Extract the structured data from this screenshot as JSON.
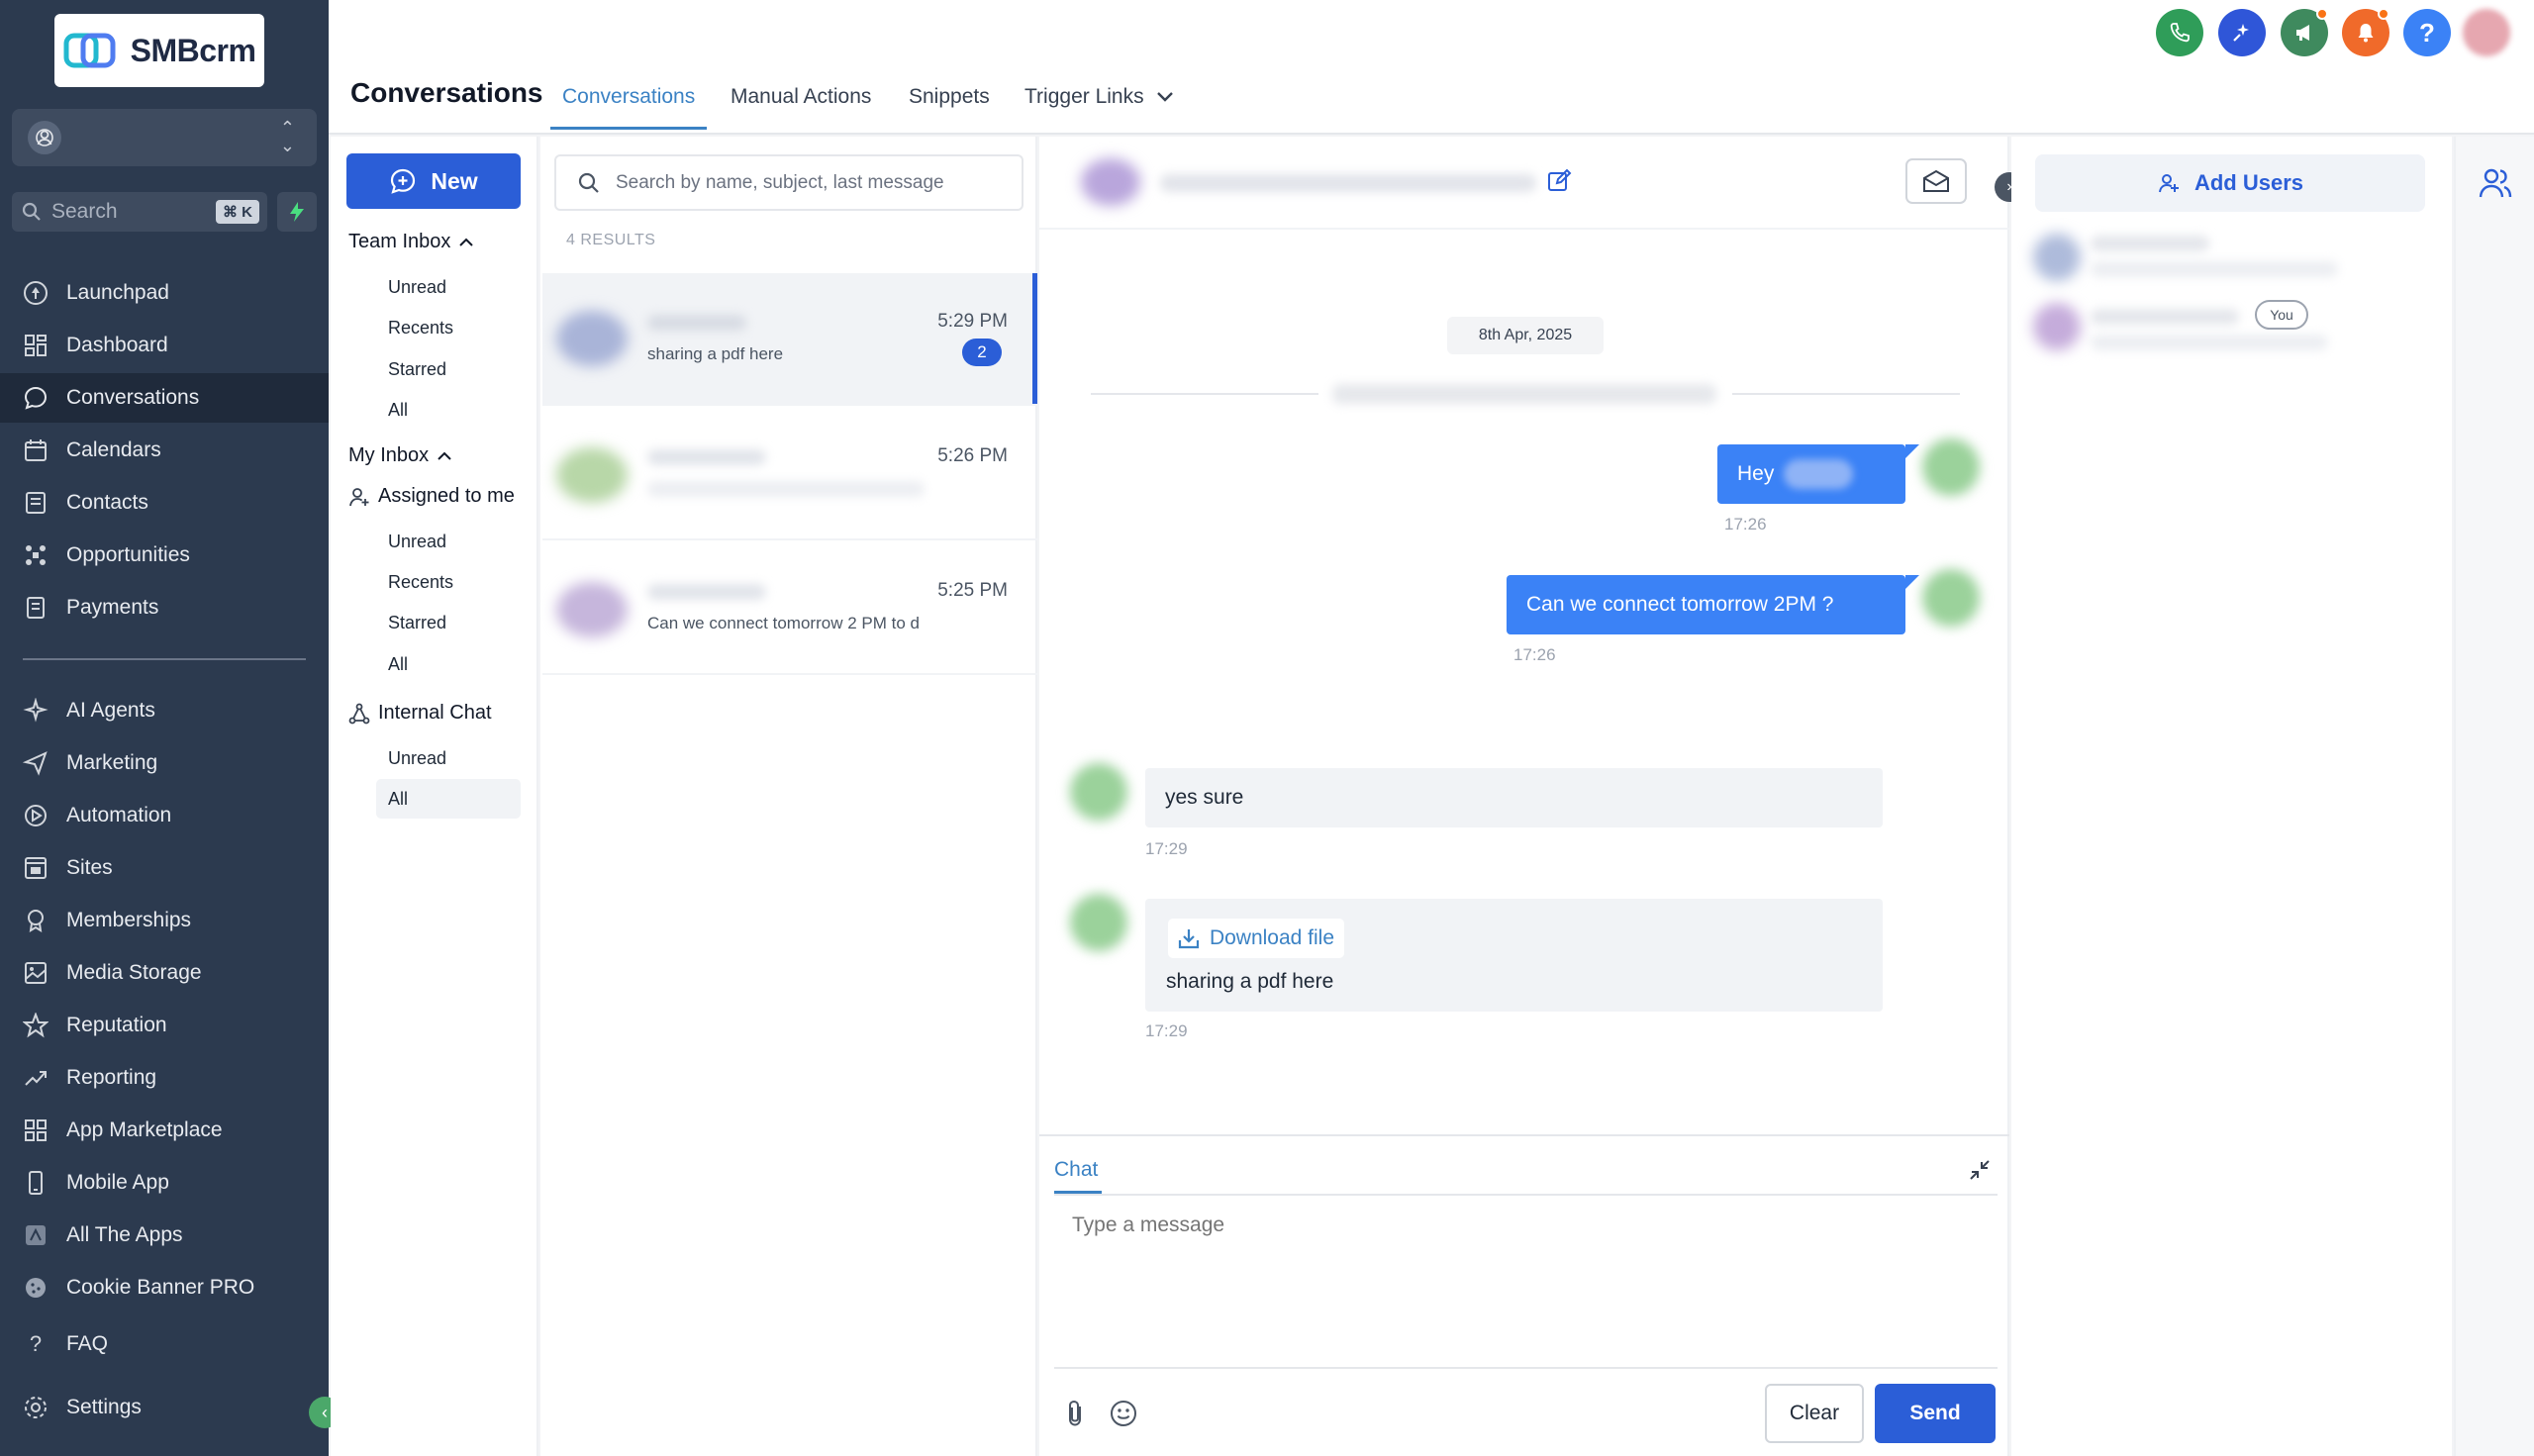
{
  "brand": {
    "name": "SMBcrm"
  },
  "sidebar": {
    "search_label": "Search",
    "search_shortcut": "⌘ K",
    "items": [
      {
        "label": "Launchpad",
        "icon": "launchpad-icon"
      },
      {
        "label": "Dashboard",
        "icon": "dashboard-icon"
      },
      {
        "label": "Conversations",
        "icon": "conversations-icon",
        "active": true
      },
      {
        "label": "Calendars",
        "icon": "calendar-icon"
      },
      {
        "label": "Contacts",
        "icon": "contacts-icon"
      },
      {
        "label": "Opportunities",
        "icon": "opportunities-icon"
      },
      {
        "label": "Payments",
        "icon": "payments-icon"
      },
      {
        "label": "AI Agents",
        "icon": "ai-agents-icon"
      },
      {
        "label": "Marketing",
        "icon": "marketing-icon"
      },
      {
        "label": "Automation",
        "icon": "automation-icon"
      },
      {
        "label": "Sites",
        "icon": "sites-icon"
      },
      {
        "label": "Memberships",
        "icon": "memberships-icon"
      },
      {
        "label": "Media Storage",
        "icon": "media-storage-icon"
      },
      {
        "label": "Reputation",
        "icon": "reputation-icon"
      },
      {
        "label": "Reporting",
        "icon": "reporting-icon"
      },
      {
        "label": "App Marketplace",
        "icon": "app-marketplace-icon"
      },
      {
        "label": "Mobile App",
        "icon": "mobile-app-icon"
      },
      {
        "label": "All The Apps",
        "icon": "all-apps-icon"
      },
      {
        "label": "Cookie Banner PRO",
        "icon": "cookie-icon"
      },
      {
        "label": "FAQ",
        "icon": "faq-icon"
      },
      {
        "label": "Settings",
        "icon": "settings-icon"
      }
    ]
  },
  "header": {
    "title": "Conversations",
    "tabs": [
      {
        "label": "Conversations",
        "active": true
      },
      {
        "label": "Manual Actions"
      },
      {
        "label": "Snippets"
      },
      {
        "label": "Trigger Links"
      }
    ]
  },
  "inbox": {
    "new_label": "New",
    "team_inbox": {
      "label": "Team Inbox",
      "items": [
        "Unread",
        "Recents",
        "Starred",
        "All"
      ]
    },
    "my_inbox": {
      "label": "My Inbox",
      "assigned_label": "Assigned to me",
      "items": [
        "Unread",
        "Recents",
        "Starred",
        "All"
      ]
    },
    "internal_chat": {
      "label": "Internal Chat",
      "items": [
        "Unread",
        "All"
      ]
    }
  },
  "conv_list": {
    "search_placeholder": "Search by name, subject, last message",
    "results": "4 RESULTS",
    "rows": [
      {
        "time": "5:29 PM",
        "snippet": "sharing a pdf here",
        "unread": "2"
      },
      {
        "time": "5:26 PM",
        "snippet": ""
      },
      {
        "time": "5:25 PM",
        "snippet": "Can we connect tomorrow 2 PM to d"
      }
    ]
  },
  "chat": {
    "date": "8th Apr, 2025",
    "messages": [
      {
        "dir": "out",
        "text": "Hey",
        "time": "17:26"
      },
      {
        "dir": "out",
        "text": "Can we connect tomorrow 2PM ?",
        "time": "17:26"
      },
      {
        "dir": "in",
        "text": "yes sure",
        "time": "17:29"
      },
      {
        "dir": "in",
        "text": "sharing a pdf here",
        "attachment": "Download file",
        "time": "17:29"
      }
    ],
    "composer": {
      "tab": "Chat",
      "placeholder": "Type a message",
      "clear_label": "Clear",
      "send_label": "Send"
    }
  },
  "right_panel": {
    "add_users_label": "Add Users",
    "you_label": "You"
  },
  "colors": {
    "sidebar_bg": "#2c3a4f",
    "primary": "#2b5ed7",
    "accent_tab": "#3b82c4",
    "outgoing_bubble": "#3b82f6",
    "incoming_bubble": "#f1f3f6"
  }
}
